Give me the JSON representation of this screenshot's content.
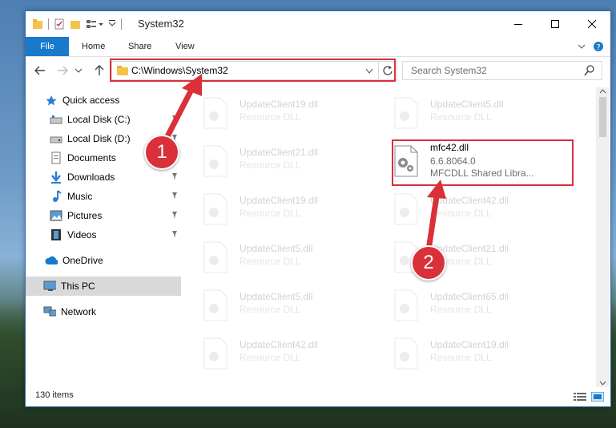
{
  "window": {
    "title": "System32"
  },
  "ribbon": {
    "tabs": [
      "File",
      "Home",
      "Share",
      "View"
    ]
  },
  "address": {
    "path": "C:\\Windows\\System32"
  },
  "search": {
    "placeholder": "Search System32"
  },
  "sidebar": {
    "items": [
      {
        "label": "Quick access",
        "icon": "star-icon"
      },
      {
        "label": "Local Disk (C:)",
        "icon": "drive-icon"
      },
      {
        "label": "Local Disk (D:)",
        "icon": "drive-icon"
      },
      {
        "label": "Documents",
        "icon": "documents-icon"
      },
      {
        "label": "Downloads",
        "icon": "download-icon"
      },
      {
        "label": "Music",
        "icon": "music-icon"
      },
      {
        "label": "Pictures",
        "icon": "pictures-icon"
      },
      {
        "label": "Videos",
        "icon": "videos-icon"
      },
      {
        "label": "OneDrive",
        "icon": "cloud-icon"
      },
      {
        "label": "This PC",
        "icon": "computer-icon"
      },
      {
        "label": "Network",
        "icon": "network-icon"
      }
    ]
  },
  "files": {
    "left": [
      {
        "name": "UpdateClient19.dll",
        "desc": "Resource DLL"
      },
      {
        "name": "UpdateClient21.dll",
        "desc": "Resource DLL"
      },
      {
        "name": "UpdateClient19.dll",
        "desc": "Resource DLL"
      },
      {
        "name": "UpdateClient5.dll",
        "desc": "Resource DLL"
      },
      {
        "name": "UpdateClient5.dll",
        "desc": "Resource DLL"
      },
      {
        "name": "UpdateClient42.dll",
        "desc": "Resource DLL"
      }
    ],
    "right": [
      {
        "name": "UpdateClient5.dll",
        "desc": "Resource DLL"
      },
      {
        "name": "UpdateClient42.dll",
        "desc": "Resource DLL"
      },
      {
        "name": "UpdateClient21.dll",
        "desc": "Resource DLL"
      },
      {
        "name": "UpdateClient65.dll",
        "desc": "Resource DLL"
      },
      {
        "name": "UpdateClient19.dll",
        "desc": "Resource DLL"
      }
    ],
    "highlighted": {
      "name": "mfc42.dll",
      "version": "6.6.8064.0",
      "desc": "MFCDLL Shared Libra..."
    }
  },
  "status": {
    "count": "130 items"
  },
  "annotations": {
    "badge1": "1",
    "badge2": "2",
    "color": "#d9303a"
  }
}
